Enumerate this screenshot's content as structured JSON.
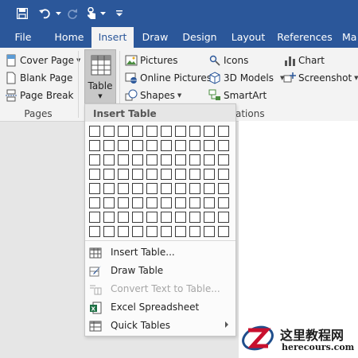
{
  "quick_access": {
    "save_icon": "save-icon",
    "undo_icon": "undo-icon",
    "redo_icon": "redo-icon",
    "touch_icon": "touch-mode-icon",
    "customize_icon": "customize-qat-icon"
  },
  "tabs": [
    {
      "label": "File"
    },
    {
      "label": "Home"
    },
    {
      "label": "Insert",
      "active": true
    },
    {
      "label": "Draw"
    },
    {
      "label": "Design"
    },
    {
      "label": "Layout"
    },
    {
      "label": "References"
    },
    {
      "label": "Ma"
    }
  ],
  "ribbon": {
    "pages_group": {
      "label": "Pages",
      "cover_page": "Cover Page",
      "blank_page": "Blank Page",
      "page_break": "Page Break"
    },
    "tables_group": {
      "table_label": "Table"
    },
    "illustrations_group": {
      "label": "ations",
      "pictures": "Pictures",
      "online_pictures": "Online Pictures",
      "shapes": "Shapes",
      "icons": "Icons",
      "models_3d": "3D Models",
      "smartart": "SmartArt",
      "chart": "Chart",
      "screenshot": "Screenshot"
    }
  },
  "insert_table_menu": {
    "header": "Insert Table",
    "grid_columns": 10,
    "grid_rows": 8,
    "items": [
      {
        "label": "Insert Table...",
        "icon": "insert-table-icon",
        "enabled": true
      },
      {
        "label": "Draw Table",
        "icon": "draw-table-icon",
        "enabled": true
      },
      {
        "label": "Convert Text to Table...",
        "icon": "convert-text-icon",
        "enabled": false
      },
      {
        "label": "Excel Spreadsheet",
        "icon": "excel-icon",
        "enabled": true
      },
      {
        "label": "Quick Tables",
        "icon": "quick-tables-icon",
        "enabled": true,
        "submenu": true
      }
    ]
  },
  "colors": {
    "ribbon_blue": "#2b579a",
    "ribbon_gray": "#f3f3f3",
    "watermark_red": "#c8102e",
    "watermark_blue": "#1f4e8c"
  },
  "watermark": {
    "title": "这里教程网",
    "url": "herecours.com"
  }
}
